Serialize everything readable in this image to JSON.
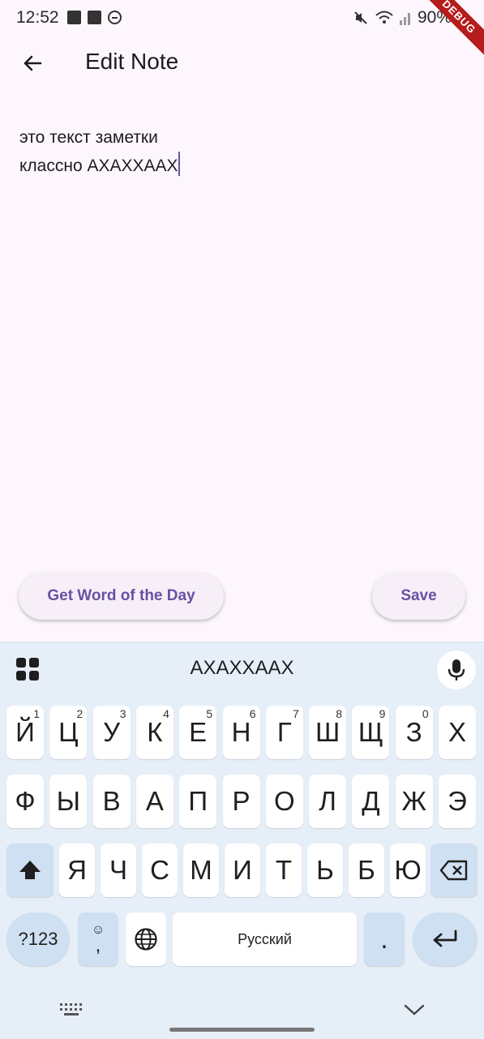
{
  "status_bar": {
    "time": "12:52",
    "battery": "90%"
  },
  "debug_banner": "DEBUG",
  "appbar": {
    "title": "Edit Note"
  },
  "note": {
    "line1": "это текст заметки",
    "line2": "классно АХАХХААХ"
  },
  "buttons": {
    "word_of_day": "Get Word of the Day",
    "save": "Save"
  },
  "keyboard": {
    "suggestion": "АХАХХААХ",
    "row1": [
      {
        "label": "Й",
        "hint": "1"
      },
      {
        "label": "Ц",
        "hint": "2"
      },
      {
        "label": "У",
        "hint": "3"
      },
      {
        "label": "К",
        "hint": "4"
      },
      {
        "label": "Е",
        "hint": "5"
      },
      {
        "label": "Н",
        "hint": "6"
      },
      {
        "label": "Г",
        "hint": "7"
      },
      {
        "label": "Ш",
        "hint": "8"
      },
      {
        "label": "Щ",
        "hint": "9"
      },
      {
        "label": "З",
        "hint": "0"
      },
      {
        "label": "Х",
        "hint": ""
      }
    ],
    "row2": [
      "Ф",
      "Ы",
      "В",
      "А",
      "П",
      "Р",
      "О",
      "Л",
      "Д",
      "Ж",
      "Э"
    ],
    "row3": [
      "Я",
      "Ч",
      "С",
      "М",
      "И",
      "Т",
      "Ь",
      "Б",
      "Ю"
    ],
    "symbols_label": "?123",
    "emoji_comma": ",",
    "space_label": "Русский",
    "period_label": "."
  },
  "colors": {
    "accent": "#6750a4",
    "background": "#fdf7fd",
    "keyboard_bg": "#e6eef7",
    "func_key": "#cfe0f2"
  }
}
